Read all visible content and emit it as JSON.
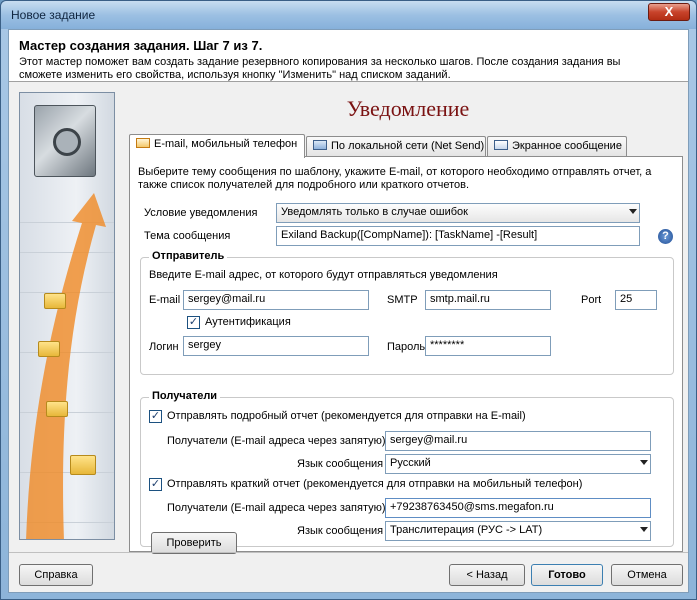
{
  "window": {
    "title": "Новое задание",
    "close": "X"
  },
  "header": {
    "title": "Мастер создания задания.  Шаг 7 из 7.",
    "description": "Этот мастер поможет вам создать задание резервного копирования за несколько шагов. После создания задания вы сможете изменить его свойства, используя кнопку \"Изменить\" над списком заданий."
  },
  "page_title": "Уведомление",
  "tabs": [
    {
      "label": "E-mail, мобильный телефон"
    },
    {
      "label": "По локальной сети (Net Send)"
    },
    {
      "label": "Экранное сообщение"
    }
  ],
  "intro": "Выберите тему сообщения по шаблону, укажите E-mail, от которого необходимо отправлять отчет, а также список получателей для подробного или краткого отчетов.",
  "condition": {
    "label": "Условие уведомления",
    "value": "Уведомлять только в случае ошибок"
  },
  "subject": {
    "label": "Тема сообщения",
    "value": "Exiland Backup([CompName]): [TaskName] -[Result]",
    "help": "?"
  },
  "sender": {
    "title": "Отправитель",
    "hint": "Введите E-mail адрес, от которого будут отправляться уведомления",
    "email_label": "E-mail",
    "email_value": "sergey@mail.ru",
    "smtp_label": "SMTP",
    "smtp_value": "smtp.mail.ru",
    "port_label": "Port",
    "port_value": "25",
    "auth_label": "Аутентификация",
    "auth_check": "✓",
    "login_label": "Логин",
    "login_value": "sergey",
    "password_label": "Пароль",
    "password_value": "********"
  },
  "recipients": {
    "title": "Получатели",
    "detailed_label": "Отправлять подробный отчет (рекомендуется для отправки на E-mail)",
    "detailed_check": "✓",
    "detailed_to_label": "Получатели (E-mail адреса через запятую)",
    "detailed_to_value": "sergey@mail.ru",
    "detailed_lang_label": "Язык сообщения",
    "detailed_lang_value": "Русский",
    "short_label": "Отправлять краткий отчет (рекомендуется для отправки на мобильный телефон)",
    "short_check": "✓",
    "short_to_label": "Получатели (E-mail адреса через запятую)",
    "short_to_value": "+79238763450@sms.megafon.ru",
    "short_lang_label": "Язык сообщения",
    "short_lang_value": "Транслитерация (РУС -> LAT)",
    "test_button": "Проверить"
  },
  "footer": {
    "help": "Справка",
    "back": "< Назад",
    "finish": "Готово",
    "cancel": "Отмена"
  }
}
